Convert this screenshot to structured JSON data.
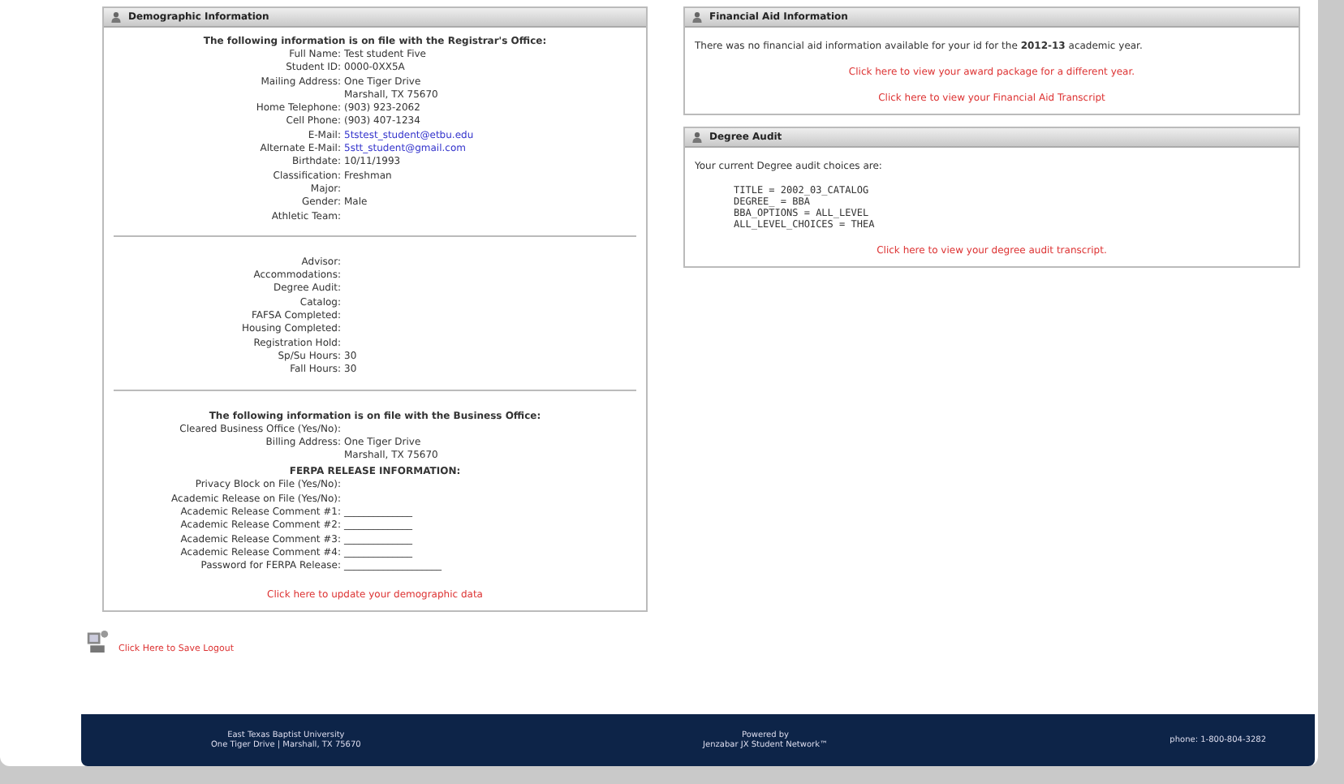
{
  "demographic": {
    "title": "Demographic Information",
    "registrar_heading": "The following information is on file with the Registrar's Office:",
    "registrar_fields": [
      {
        "label": "Full Name:",
        "values": [
          "Test student Five"
        ]
      },
      {
        "label": "Student ID:",
        "values": [
          "0000-0XX5A"
        ]
      },
      {
        "label": "Mailing Address:",
        "values": [
          "One Tiger Drive",
          "Marshall, TX 75670"
        ]
      },
      {
        "label": "Home Telephone:",
        "values": [
          "(903) 923-2062"
        ]
      },
      {
        "label": "Cell Phone:",
        "values": [
          "(903) 407-1234"
        ]
      },
      {
        "label": "E-Mail:",
        "links": [
          "5tstest_student@etbu.edu"
        ]
      },
      {
        "label": "Alternate E-Mail:",
        "links": [
          "5stt_student@gmail.com"
        ]
      },
      {
        "label": "Birthdate:",
        "values": [
          "10/11/1993"
        ]
      },
      {
        "label": "Classification:",
        "values": [
          "Freshman"
        ]
      },
      {
        "label": "Major:"
      },
      {
        "label": "Gender:",
        "values": [
          "Male"
        ]
      },
      {
        "label": "Athletic Team:"
      }
    ],
    "other_fields": [
      {
        "label": "Advisor:"
      },
      {
        "label": "Accommodations:"
      },
      {
        "label": "Degree Audit:"
      },
      {
        "label": "Catalog:"
      },
      {
        "label": "FAFSA Completed:"
      },
      {
        "label": "Housing Completed:"
      },
      {
        "label": "Registration Hold:"
      },
      {
        "label": "Sp/Su Hours:",
        "values": [
          "30"
        ]
      },
      {
        "label": "Fall Hours:",
        "values": [
          "30"
        ]
      }
    ],
    "business_heading": "The following information is on file with the Business Office:",
    "business_fields": [
      {
        "label": "Cleared Business Office (Yes/No):"
      },
      {
        "label": "Billing Address:",
        "values": [
          "One Tiger Drive",
          "Marshall, TX 75670"
        ]
      }
    ],
    "ferpa_heading": "FERPA RELEASE INFORMATION:",
    "ferpa_fields": [
      {
        "label": "Privacy Block on File (Yes/No):"
      },
      {
        "label": "Academic Release on File (Yes/No):"
      },
      {
        "label": "Academic Release Comment #1:",
        "values": [
          "______________"
        ]
      },
      {
        "label": "Academic Release Comment #2:",
        "values": [
          "______________"
        ]
      },
      {
        "label": "Academic Release Comment #3:",
        "values": [
          "______________"
        ]
      },
      {
        "label": "Academic Release Comment #4:",
        "values": [
          "______________"
        ]
      },
      {
        "label": "Password for FERPA Release:",
        "values": [
          "____________________"
        ]
      }
    ],
    "update_link": "Click here to update your demographic data"
  },
  "financial": {
    "title": "Financial Aid Information",
    "message": "There was no financial aid information available for your id for the **2012-13** academic year.",
    "links": [
      "Click here to view your award package for a different year.",
      "Click here to view your Financial Aid Transcript"
    ]
  },
  "degree_audit": {
    "title": "Degree Audit",
    "intro": "Your current Degree audit choices are:",
    "choices": [
      "TITLE = 2002_03_CATALOG",
      "DEGREE_ = BBA",
      "BBA_OPTIONS = ALL_LEVEL",
      "ALL_LEVEL_CHOICES = THEA"
    ],
    "link": "Click here to view your degree audit transcript."
  },
  "logout_link": "Click Here to Save Logout",
  "footer": {
    "left": [
      "East Texas Baptist University",
      "One Tiger Drive | Marshall, TX 75670"
    ],
    "center": [
      "Powered by",
      "Jenzabar JX Student Network™"
    ],
    "right": "phone: 1-800-804-3282"
  }
}
